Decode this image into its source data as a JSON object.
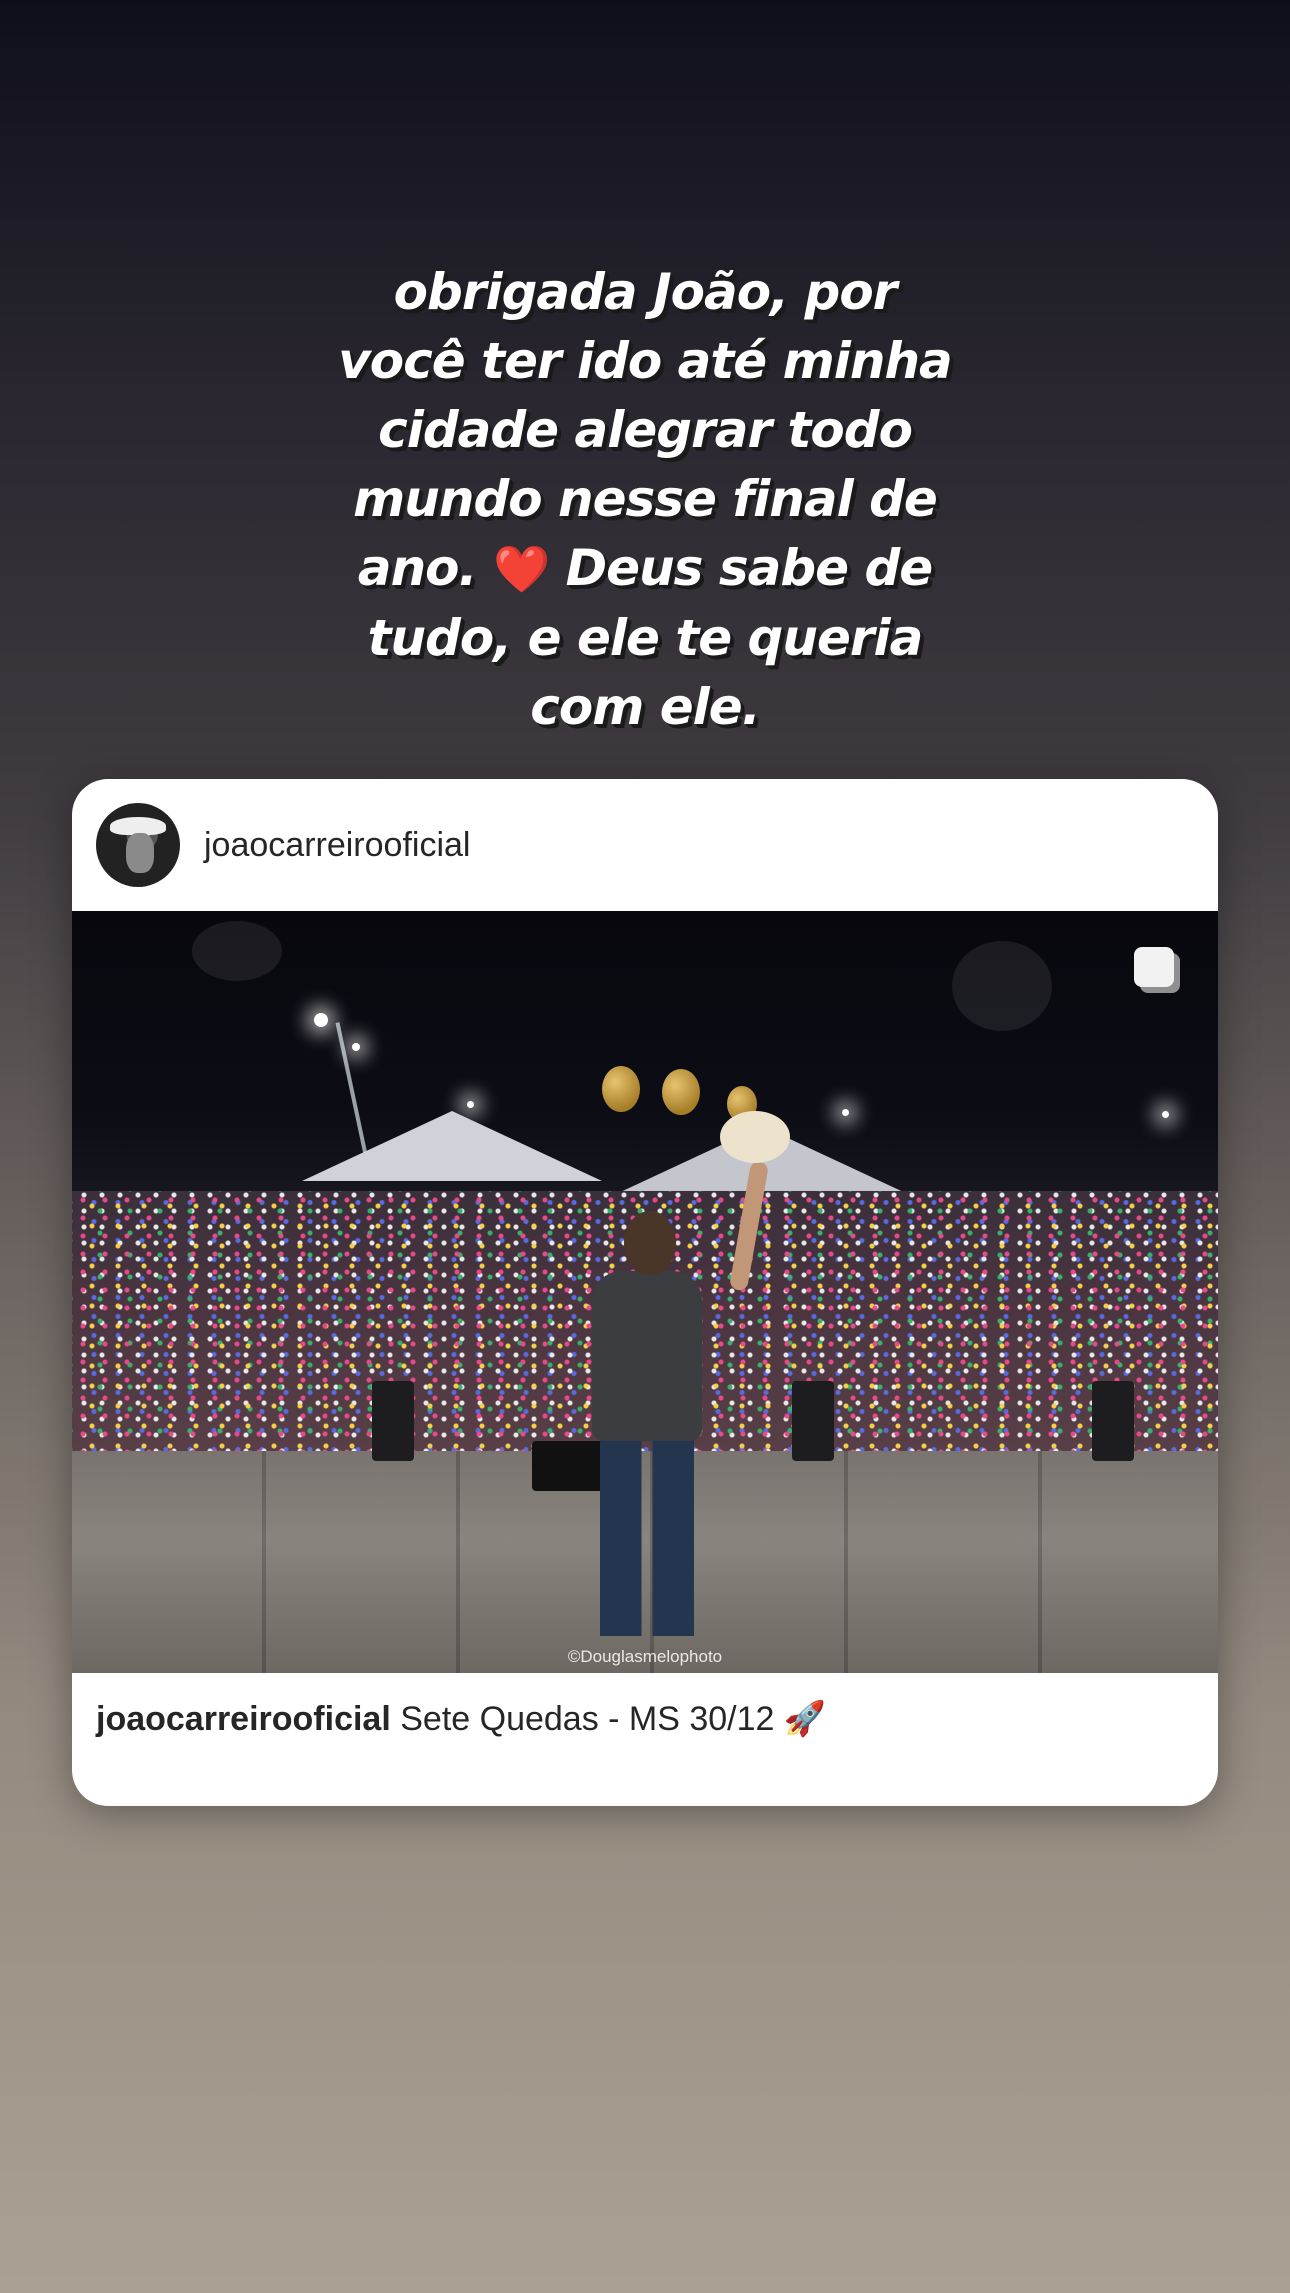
{
  "story": {
    "caption_part1": "obrigada João, por você ter ido até minha cidade alegrar todo mundo nesse final de ano.",
    "heart": "❤️",
    "caption_part2": "Deus sabe de tudo, e ele te queria com ele."
  },
  "post": {
    "username": "joaocarreirooficial",
    "photo_credit": "©Douglasmelophoto",
    "caption_username": "joaocarreirooficial",
    "caption_text": "Sete Quedas - MS 30/12 🚀",
    "multi_photo_icon": "carousel-icon"
  }
}
